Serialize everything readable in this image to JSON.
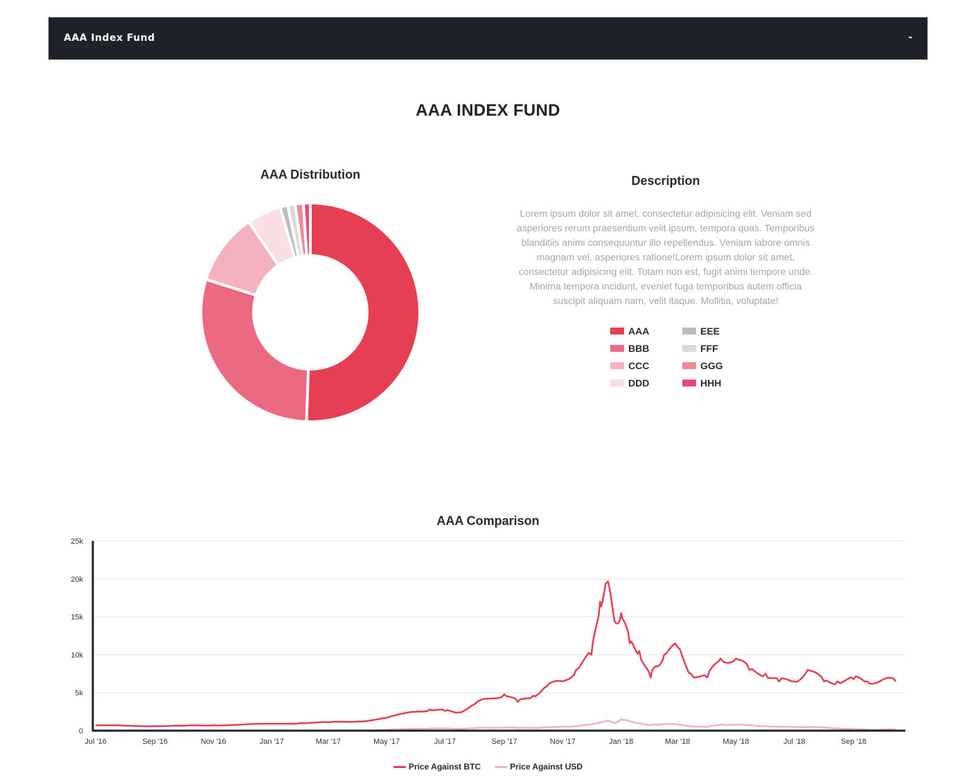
{
  "nav": {
    "brand": "AAA Index Fund",
    "toggle": "-"
  },
  "page_title": "AAA INDEX FUND",
  "distribution": {
    "title": "AAA Distribution"
  },
  "description": {
    "title": "Description",
    "text": "Lorem ipsum dolor sit amet, consectetur adipisicing elit. Veniam sed asperiores rerum praesentium velit ipsum, tempora quas. Temporibus blanditiis animi consequuntur illo repellendus. Veniam labore omnis magnam vel, asperiores ratione!Lorem ipsum dolor sit amet, consectetur adipisicing elit. Totam non est, fugit animi tempore unde. Minima tempora incidunt, eveniet fuga temporibus autem officia suscipit aliquam nam, velit itaque. Mollitia, voluptate!"
  },
  "legend": [
    {
      "label": "AAA",
      "color": "#e63e53"
    },
    {
      "label": "BBB",
      "color": "#eb6a82"
    },
    {
      "label": "CCC",
      "color": "#f3b2bd"
    },
    {
      "label": "DDD",
      "color": "#f9dfe4"
    },
    {
      "label": "EEE",
      "color": "#bdbdbd"
    },
    {
      "label": "FFF",
      "color": "#d9d9d9"
    },
    {
      "label": "GGG",
      "color": "#ee8a99"
    },
    {
      "label": "HHH",
      "color": "#e74a77"
    }
  ],
  "comparison": {
    "title": "AAA Comparison"
  },
  "chart_data": [
    {
      "type": "pie",
      "title": "AAA Distribution",
      "categories": [
        "AAA",
        "BBB",
        "CCC",
        "DDD",
        "EEE",
        "FFF",
        "GGG",
        "HHH"
      ],
      "values": [
        50.0,
        29.0,
        10.5,
        5.0,
        1.1,
        1.1,
        1.2,
        1.0
      ],
      "colors": [
        "#e63e53",
        "#eb6a82",
        "#f3b2bd",
        "#f9dfe4",
        "#bdbdbd",
        "#d9d9d9",
        "#ee8a99",
        "#e74a77"
      ]
    },
    {
      "type": "line",
      "title": "AAA Comparison",
      "x_ticks": [
        "Jul '16",
        "Sep '16",
        "Nov '16",
        "Jan '17",
        "Mar '17",
        "May '17",
        "Jul '17",
        "Sep '17",
        "Nov '17",
        "Jan '18",
        "Mar '18",
        "May '18",
        "Jul '18",
        "Sep '18"
      ],
      "y_ticks": [
        "0",
        "5k",
        "10k",
        "15k",
        "20k",
        "25k"
      ],
      "ylim": [
        0,
        25000
      ],
      "grid": true,
      "legend_position": "bottom",
      "x": [
        "2016-07-01",
        "2016-08-01",
        "2016-09-01",
        "2016-10-01",
        "2016-11-01",
        "2016-12-01",
        "2017-01-01",
        "2017-02-01",
        "2017-03-01",
        "2017-04-01",
        "2017-05-01",
        "2017-06-01",
        "2017-06-15",
        "2017-07-01",
        "2017-07-15",
        "2017-08-01",
        "2017-08-15",
        "2017-09-01",
        "2017-09-15",
        "2017-10-01",
        "2017-10-15",
        "2017-11-01",
        "2017-11-15",
        "2017-12-01",
        "2017-12-10",
        "2017-12-17",
        "2017-12-25",
        "2018-01-01",
        "2018-01-10",
        "2018-01-20",
        "2018-02-01",
        "2018-02-06",
        "2018-02-15",
        "2018-03-01",
        "2018-03-15",
        "2018-04-01",
        "2018-04-15",
        "2018-05-01",
        "2018-05-15",
        "2018-06-01",
        "2018-06-15",
        "2018-07-01",
        "2018-07-15",
        "2018-08-01",
        "2018-08-15",
        "2018-09-01",
        "2018-09-15",
        "2018-10-01",
        "2018-10-15"
      ],
      "series": [
        {
          "name": "Price Against BTC",
          "color": "#e63e53",
          "values": [
            700,
            650,
            600,
            650,
            700,
            800,
            900,
            1000,
            1100,
            1200,
            1700,
            2500,
            2800,
            2600,
            2400,
            3500,
            4200,
            4800,
            3800,
            4600,
            5800,
            6500,
            8000,
            10000,
            17000,
            19500,
            14500,
            15500,
            11500,
            10500,
            7000,
            8500,
            10000,
            11000,
            7500,
            7000,
            9500,
            9500,
            8000,
            7500,
            6500,
            6500,
            8000,
            6500,
            6500,
            6800,
            6500,
            6700,
            6500
          ]
        },
        {
          "name": "Price Against USD",
          "color": "#f3b2bd",
          "values": [
            0,
            0,
            0,
            0,
            0,
            0,
            0,
            0,
            0,
            0,
            100,
            250,
            300,
            280,
            260,
            330,
            380,
            420,
            360,
            380,
            420,
            520,
            620,
            800,
            1100,
            1300,
            1000,
            1500,
            1200,
            1000,
            700,
            800,
            900,
            800,
            600,
            500,
            800,
            800,
            700,
            600,
            500,
            500,
            500,
            400,
            300,
            200,
            150,
            150,
            150
          ]
        }
      ]
    }
  ]
}
